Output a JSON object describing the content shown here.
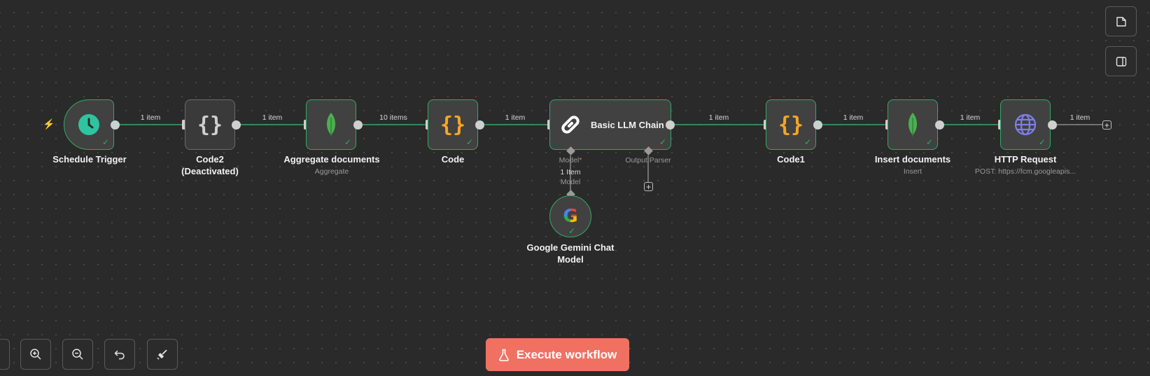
{
  "nodes": {
    "schedule_trigger": {
      "name": "Schedule Trigger"
    },
    "code2": {
      "name": "Code2",
      "status": "(Deactivated)"
    },
    "aggregate_documents": {
      "name": "Aggregate documents",
      "subtitle": "Aggregate"
    },
    "code": {
      "name": "Code"
    },
    "basic_llm_chain": {
      "name": "Basic LLM Chain",
      "model_port": "Model",
      "model_port_required": "*",
      "output_parser_port": "Output Parser"
    },
    "gemini": {
      "name_line1": "Google Gemini Chat",
      "name_line2": "Model",
      "edge_count": "1 Item",
      "edge_type": "Model"
    },
    "code1": {
      "name": "Code1"
    },
    "insert_documents": {
      "name": "Insert documents",
      "subtitle": "Insert"
    },
    "http_request": {
      "name": "HTTP Request",
      "subtitle": "POST: https://fcm.googleapis..."
    }
  },
  "edges": {
    "e1": "1 item",
    "e2": "1 item",
    "e3": "10 items",
    "e4": "1 item",
    "e5": "1 item",
    "e6": "1 item",
    "e7": "1 item",
    "e8": "1 item"
  },
  "controls": {
    "zoom_in_icon": "zoom-in-icon",
    "zoom_out_icon": "zoom-out-icon",
    "undo_icon": "undo-icon",
    "tidy_icon": "broom-icon"
  },
  "execute_button": {
    "label": "Execute workflow"
  },
  "colors": {
    "background": "#2a2a2a",
    "success_border": "#34a867",
    "accent": "#f07162",
    "mongodb_green": "#4caf50",
    "code_orange": "#f5a623",
    "trigger_teal": "#2ec4a0",
    "globe_purple": "#7f7fe6"
  }
}
